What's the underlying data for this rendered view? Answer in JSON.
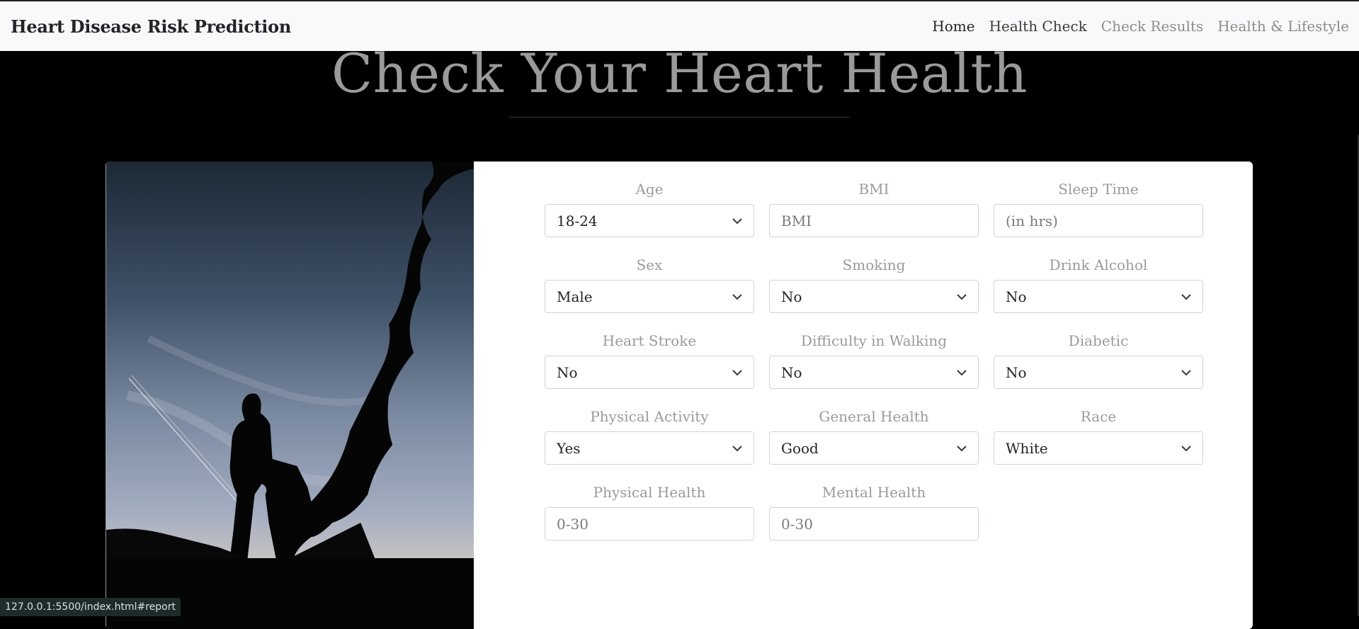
{
  "navbar": {
    "brand": "Heart Disease Risk Prediction",
    "links": [
      "Home",
      "Health Check",
      "Check Results",
      "Health & Lifestyle"
    ]
  },
  "hero": {
    "title": "Check Your Heart Health"
  },
  "form": {
    "age": {
      "label": "Age",
      "value": "18-24"
    },
    "bmi": {
      "label": "BMI",
      "placeholder": "BMI"
    },
    "sleep": {
      "label": "Sleep Time",
      "placeholder": "(in hrs)"
    },
    "sex": {
      "label": "Sex",
      "value": "Male"
    },
    "smoking": {
      "label": "Smoking",
      "value": "No"
    },
    "alcohol": {
      "label": "Drink Alcohol",
      "value": "No"
    },
    "stroke": {
      "label": "Heart Stroke",
      "value": "No"
    },
    "walking": {
      "label": "Difficulty in Walking",
      "value": "No"
    },
    "diabetic": {
      "label": "Diabetic",
      "value": "No"
    },
    "activity": {
      "label": "Physical Activity",
      "value": "Yes"
    },
    "general": {
      "label": "General Health",
      "value": "Good"
    },
    "race": {
      "label": "Race",
      "value": "White"
    },
    "phys_health": {
      "label": "Physical Health",
      "placeholder": "0-30"
    },
    "mental_health": {
      "label": "Mental Health",
      "placeholder": "0-30"
    }
  },
  "status_bar": {
    "url": "127.0.0.1:5500/index.html#report"
  }
}
